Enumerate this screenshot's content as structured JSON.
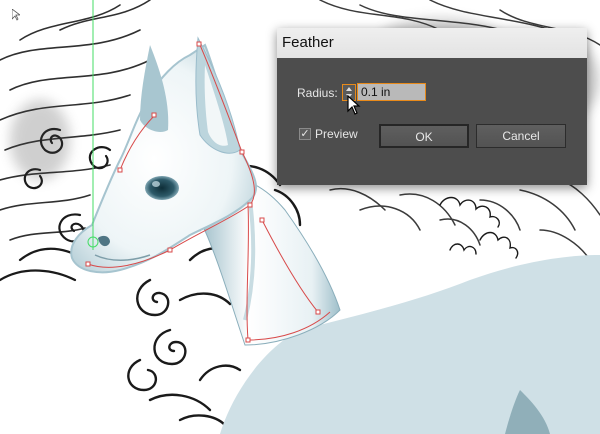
{
  "dialog": {
    "title": "Feather",
    "radius_label": "Radius:",
    "radius_value": "0.1 in",
    "preview_label": "Preview",
    "preview_checked": true,
    "ok_label": "OK",
    "cancel_label": "Cancel"
  },
  "colors": {
    "dialog_bg": "#4d4d4d",
    "focus_orange": "#e88a1a",
    "horse_fill": "#cfe0e6",
    "horse_highlight": "#ffffff",
    "guide_green": "#44dd66",
    "path_red": "#d84a4a"
  },
  "icons": {
    "cursor": "arrow-pointer-icon",
    "stepper": "stepper-arrows-icon",
    "check": "checkmark-icon"
  }
}
